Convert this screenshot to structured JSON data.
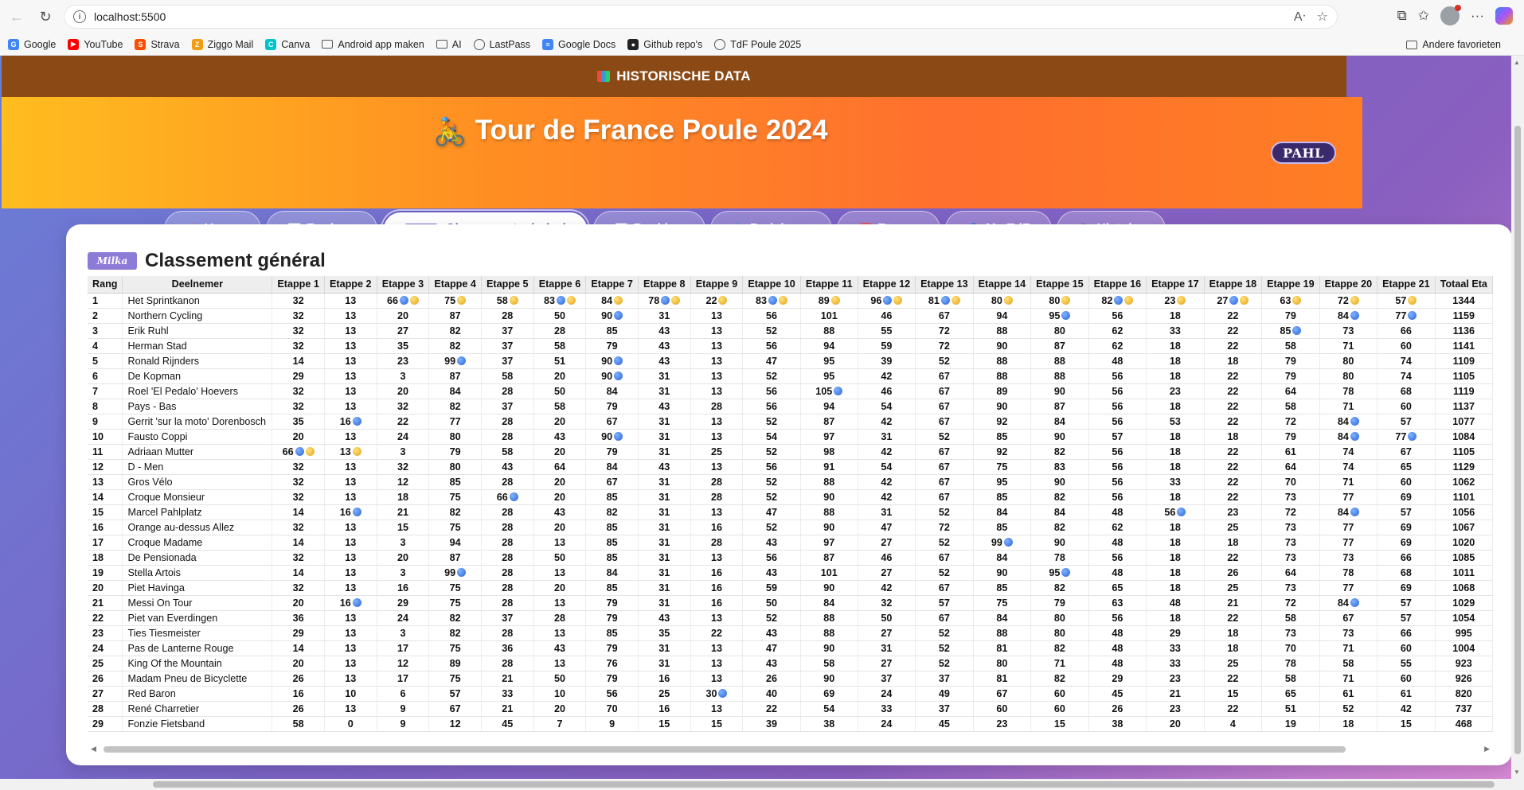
{
  "browser": {
    "url": "localhost:5500",
    "bookmarks": [
      {
        "label": "Google",
        "color": "#4285f4",
        "type": "icon",
        "glyph": "G"
      },
      {
        "label": "YouTube",
        "color": "#ff0000",
        "type": "icon",
        "glyph": "▶"
      },
      {
        "label": "Strava",
        "color": "#fc4c02",
        "type": "icon",
        "glyph": "S"
      },
      {
        "label": "Ziggo Mail",
        "color": "#f39c12",
        "type": "icon",
        "glyph": "Z"
      },
      {
        "label": "Canva",
        "color": "#00c4cc",
        "type": "icon",
        "glyph": "C"
      },
      {
        "label": "Android app maken",
        "type": "folder"
      },
      {
        "label": "AI",
        "type": "folder"
      },
      {
        "label": "LastPass",
        "type": "globe"
      },
      {
        "label": "Google Docs",
        "color": "#4285f4",
        "type": "icon",
        "glyph": "≡"
      },
      {
        "label": "Github repo's",
        "color": "#222222",
        "type": "icon",
        "glyph": "●"
      },
      {
        "label": "TdF Poule 2025",
        "type": "globe"
      }
    ],
    "other_bookmarks": "Andere favorieten"
  },
  "banner": {
    "label": "HISTORISCHE DATA"
  },
  "header": {
    "title": "Tour de France Poule 2024",
    "logo_text": "PAHL"
  },
  "nav": [
    {
      "icon": "🏠",
      "label": "Home",
      "active": false
    },
    {
      "icon": "📊",
      "label": "Equipes",
      "active": false
    },
    {
      "icon": "",
      "label": "Classement général",
      "active": true
    },
    {
      "icon": "📈",
      "label": "Ranking",
      "active": false
    },
    {
      "icon": "🚴",
      "label": "Pedaleurs",
      "active": false
    },
    {
      "icon": "📅",
      "label": "Etapes",
      "active": false
    },
    {
      "icon": "👤",
      "label": "My TdF",
      "active": false
    },
    {
      "icon": "📚",
      "label": "Histoire",
      "active": false
    }
  ],
  "panel": {
    "title": "Classement général",
    "logo_text": "Milka"
  },
  "table": {
    "headers": [
      "Rang",
      "Deelnemer",
      "Etappe 1",
      "Etappe 2",
      "Etappe 3",
      "Etappe 4",
      "Etappe 5",
      "Etappe 6",
      "Etappe 7",
      "Etappe 8",
      "Etappe 9",
      "Etappe 10",
      "Etappe 11",
      "Etappe 12",
      "Etappe 13",
      "Etappe 14",
      "Etappe 15",
      "Etappe 16",
      "Etappe 17",
      "Etappe 18",
      "Etappe 19",
      "Etappe 20",
      "Etappe 21",
      "Totaal Eta"
    ],
    "rows": [
      {
        "rank": "1",
        "name": "Het Sprintkanon",
        "stages": [
          "32",
          "13",
          "66 BG",
          "75 G",
          "58 G",
          "83 BG",
          "84 G",
          "78 BG",
          "22 G",
          "83 BG",
          "89 G",
          "96 BG",
          "81 BG",
          "80 G",
          "80 G",
          "82 BG",
          "23 G",
          "27 BG",
          "63 G",
          "72 G",
          "57 G"
        ],
        "total": "1344"
      },
      {
        "rank": "2",
        "name": "Northern Cycling",
        "stages": [
          "32",
          "13",
          "20",
          "87",
          "28",
          "50",
          "90 B",
          "31",
          "13",
          "56",
          "101",
          "46",
          "67",
          "94",
          "95 B",
          "56",
          "18",
          "22",
          "79",
          "84 B",
          "77 B"
        ],
        "total": "1159"
      },
      {
        "rank": "3",
        "name": "Erik Ruhl",
        "stages": [
          "32",
          "13",
          "27",
          "82",
          "37",
          "28",
          "85",
          "43",
          "13",
          "52",
          "88",
          "55",
          "72",
          "88",
          "80",
          "62",
          "33",
          "22",
          "85 B",
          "73",
          "66"
        ],
        "total": "1136"
      },
      {
        "rank": "4",
        "name": "Herman Stad",
        "stages": [
          "32",
          "13",
          "35",
          "82",
          "37",
          "58",
          "79",
          "43",
          "13",
          "56",
          "94",
          "59",
          "72",
          "90",
          "87",
          "62",
          "18",
          "22",
          "58",
          "71",
          "60"
        ],
        "total": "1141"
      },
      {
        "rank": "5",
        "name": "Ronald Rijnders",
        "stages": [
          "14",
          "13",
          "23",
          "99 B",
          "37",
          "51",
          "90 B",
          "43",
          "13",
          "47",
          "95",
          "39",
          "52",
          "88",
          "88",
          "48",
          "18",
          "18",
          "79",
          "80",
          "74"
        ],
        "total": "1109"
      },
      {
        "rank": "6",
        "name": "De Kopman",
        "stages": [
          "29",
          "13",
          "3",
          "87",
          "58",
          "20",
          "90 B",
          "31",
          "13",
          "52",
          "95",
          "42",
          "67",
          "88",
          "88",
          "56",
          "18",
          "22",
          "79",
          "80",
          "74"
        ],
        "total": "1105"
      },
      {
        "rank": "7",
        "name": "Roel 'El Pedalo' Hoevers",
        "stages": [
          "32",
          "13",
          "20",
          "84",
          "28",
          "50",
          "84",
          "31",
          "13",
          "56",
          "105 B",
          "46",
          "67",
          "89",
          "90",
          "56",
          "23",
          "22",
          "64",
          "78",
          "68"
        ],
        "total": "1119"
      },
      {
        "rank": "8",
        "name": "Pays - Bas",
        "stages": [
          "32",
          "13",
          "32",
          "82",
          "37",
          "58",
          "79",
          "43",
          "28",
          "56",
          "94",
          "54",
          "67",
          "90",
          "87",
          "56",
          "18",
          "22",
          "58",
          "71",
          "60"
        ],
        "total": "1137"
      },
      {
        "rank": "9",
        "name": "Gerrit 'sur la moto' Dorenbosch",
        "stages": [
          "35",
          "16 B",
          "22",
          "77",
          "28",
          "20",
          "67",
          "31",
          "13",
          "52",
          "87",
          "42",
          "67",
          "92",
          "84",
          "56",
          "53",
          "22",
          "72",
          "84 B",
          "57"
        ],
        "total": "1077"
      },
      {
        "rank": "10",
        "name": "Fausto Coppi",
        "stages": [
          "20",
          "13",
          "24",
          "80",
          "28",
          "43",
          "90 B",
          "31",
          "13",
          "54",
          "97",
          "31",
          "52",
          "85",
          "90",
          "57",
          "18",
          "18",
          "79",
          "84 B",
          "77 B"
        ],
        "total": "1084"
      },
      {
        "rank": "11",
        "name": "Adriaan Mutter",
        "stages": [
          "66 BG",
          "13 G",
          "3",
          "79",
          "58",
          "20",
          "79",
          "31",
          "25",
          "52",
          "98",
          "42",
          "67",
          "92",
          "82",
          "56",
          "18",
          "22",
          "61",
          "74",
          "67"
        ],
        "total": "1105"
      },
      {
        "rank": "12",
        "name": "D - Men",
        "stages": [
          "32",
          "13",
          "32",
          "80",
          "43",
          "64",
          "84",
          "43",
          "13",
          "56",
          "91",
          "54",
          "67",
          "75",
          "83",
          "56",
          "18",
          "22",
          "64",
          "74",
          "65"
        ],
        "total": "1129"
      },
      {
        "rank": "13",
        "name": "Gros Vélo",
        "stages": [
          "32",
          "13",
          "12",
          "85",
          "28",
          "20",
          "67",
          "31",
          "28",
          "52",
          "88",
          "42",
          "67",
          "95",
          "90",
          "56",
          "33",
          "22",
          "70",
          "71",
          "60"
        ],
        "total": "1062"
      },
      {
        "rank": "14",
        "name": "Croque Monsieur",
        "stages": [
          "32",
          "13",
          "18",
          "75",
          "66 B",
          "20",
          "85",
          "31",
          "28",
          "52",
          "90",
          "42",
          "67",
          "85",
          "82",
          "56",
          "18",
          "22",
          "73",
          "77",
          "69"
        ],
        "total": "1101"
      },
      {
        "rank": "15",
        "name": "Marcel Pahlplatz",
        "stages": [
          "14",
          "16 B",
          "21",
          "82",
          "28",
          "43",
          "82",
          "31",
          "13",
          "47",
          "88",
          "31",
          "52",
          "84",
          "84",
          "48",
          "56 B",
          "23",
          "72",
          "84 B",
          "57"
        ],
        "total": "1056"
      },
      {
        "rank": "16",
        "name": "Orange au-dessus Allez",
        "stages": [
          "32",
          "13",
          "15",
          "75",
          "28",
          "20",
          "85",
          "31",
          "16",
          "52",
          "90",
          "47",
          "72",
          "85",
          "82",
          "62",
          "18",
          "25",
          "73",
          "77",
          "69"
        ],
        "total": "1067"
      },
      {
        "rank": "17",
        "name": "Croque Madame",
        "stages": [
          "14",
          "13",
          "3",
          "94",
          "28",
          "13",
          "85",
          "31",
          "28",
          "43",
          "97",
          "27",
          "52",
          "99 B",
          "90",
          "48",
          "18",
          "18",
          "73",
          "77",
          "69"
        ],
        "total": "1020"
      },
      {
        "rank": "18",
        "name": "De Pensionada",
        "stages": [
          "32",
          "13",
          "20",
          "87",
          "28",
          "50",
          "85",
          "31",
          "13",
          "56",
          "87",
          "46",
          "67",
          "84",
          "78",
          "56",
          "18",
          "22",
          "73",
          "73",
          "66"
        ],
        "total": "1085"
      },
      {
        "rank": "19",
        "name": "Stella Artois",
        "stages": [
          "14",
          "13",
          "3",
          "99 B",
          "28",
          "13",
          "84",
          "31",
          "16",
          "43",
          "101",
          "27",
          "52",
          "90",
          "95 B",
          "48",
          "18",
          "26",
          "64",
          "78",
          "68"
        ],
        "total": "1011"
      },
      {
        "rank": "20",
        "name": "Piet Havinga",
        "stages": [
          "32",
          "13",
          "16",
          "75",
          "28",
          "20",
          "85",
          "31",
          "16",
          "59",
          "90",
          "42",
          "67",
          "85",
          "82",
          "65",
          "18",
          "25",
          "73",
          "77",
          "69"
        ],
        "total": "1068"
      },
      {
        "rank": "21",
        "name": "Messi On Tour",
        "stages": [
          "20",
          "16 B",
          "29",
          "75",
          "28",
          "13",
          "79",
          "31",
          "16",
          "50",
          "84",
          "32",
          "57",
          "75",
          "79",
          "63",
          "48",
          "21",
          "72",
          "84 B",
          "57"
        ],
        "total": "1029"
      },
      {
        "rank": "22",
        "name": "Piet van Everdingen",
        "stages": [
          "36",
          "13",
          "24",
          "82",
          "37",
          "28",
          "79",
          "43",
          "13",
          "52",
          "88",
          "50",
          "67",
          "84",
          "80",
          "56",
          "18",
          "22",
          "58",
          "67",
          "57"
        ],
        "total": "1054"
      },
      {
        "rank": "23",
        "name": "Ties Tiesmeister",
        "stages": [
          "29",
          "13",
          "3",
          "82",
          "28",
          "13",
          "85",
          "35",
          "22",
          "43",
          "88",
          "27",
          "52",
          "88",
          "80",
          "48",
          "29",
          "18",
          "73",
          "73",
          "66"
        ],
        "total": "995"
      },
      {
        "rank": "24",
        "name": "Pas de Lanterne Rouge",
        "stages": [
          "14",
          "13",
          "17",
          "75",
          "36",
          "43",
          "79",
          "31",
          "13",
          "47",
          "90",
          "31",
          "52",
          "81",
          "82",
          "48",
          "33",
          "18",
          "70",
          "71",
          "60"
        ],
        "total": "1004"
      },
      {
        "rank": "25",
        "name": "King Of the Mountain",
        "stages": [
          "20",
          "13",
          "12",
          "89",
          "28",
          "13",
          "76",
          "31",
          "13",
          "43",
          "58",
          "27",
          "52",
          "80",
          "71",
          "48",
          "33",
          "25",
          "78",
          "58",
          "55"
        ],
        "total": "923"
      },
      {
        "rank": "26",
        "name": "Madam Pneu de Bicyclette",
        "stages": [
          "26",
          "13",
          "17",
          "75",
          "21",
          "50",
          "79",
          "16",
          "13",
          "26",
          "90",
          "37",
          "37",
          "81",
          "82",
          "29",
          "23",
          "22",
          "58",
          "71",
          "60"
        ],
        "total": "926"
      },
      {
        "rank": "27",
        "name": "Red Baron",
        "stages": [
          "16",
          "10",
          "6",
          "57",
          "33",
          "10",
          "56",
          "25",
          "30 B",
          "40",
          "69",
          "24",
          "49",
          "67",
          "60",
          "45",
          "21",
          "15",
          "65",
          "61",
          "61"
        ],
        "total": "820"
      },
      {
        "rank": "28",
        "name": "René Charretier",
        "stages": [
          "26",
          "13",
          "9",
          "67",
          "21",
          "20",
          "70",
          "16",
          "13",
          "22",
          "54",
          "33",
          "37",
          "60",
          "60",
          "26",
          "23",
          "22",
          "51",
          "52",
          "42"
        ],
        "total": "737"
      },
      {
        "rank": "29",
        "name": "Fonzie Fietsband",
        "stages": [
          "58",
          "0",
          "9",
          "12",
          "45",
          "7",
          "9",
          "15",
          "15",
          "39",
          "38",
          "24",
          "45",
          "23",
          "15",
          "38",
          "20",
          "4",
          "19",
          "18",
          "15"
        ],
        "total": "468"
      }
    ]
  }
}
